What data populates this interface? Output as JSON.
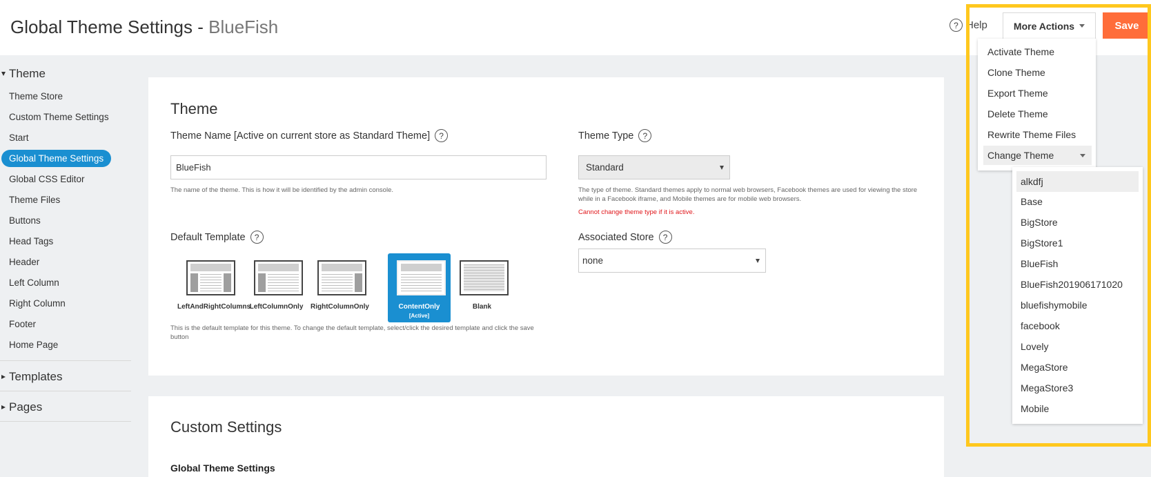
{
  "header": {
    "title": "Global Theme Settings - ",
    "title_theme": "BlueFish",
    "help_label": "Help",
    "help_icon": "?",
    "more_actions_label": "More Actions",
    "save_label": "Save"
  },
  "sidebar": {
    "theme_section": "Theme",
    "items": [
      {
        "label": "Theme Store"
      },
      {
        "label": "Custom Theme Settings"
      },
      {
        "label": "Start"
      },
      {
        "label": "Global Theme Settings"
      },
      {
        "label": "Global CSS Editor"
      },
      {
        "label": "Theme Files"
      },
      {
        "label": "Buttons"
      },
      {
        "label": "Head Tags"
      },
      {
        "label": "Header"
      },
      {
        "label": "Left Column"
      },
      {
        "label": "Right Column"
      },
      {
        "label": "Footer"
      },
      {
        "label": "Home Page"
      }
    ],
    "active_item": "Global Theme Settings",
    "templates_section": "Templates",
    "pages_section": "Pages"
  },
  "theme_panel": {
    "title": "Theme",
    "name_label": "Theme Name [Active on current store as Standard Theme]",
    "name_value": "BlueFish",
    "name_help": "The name of the theme. This is how it will be identified by the admin console.",
    "type_label": "Theme Type",
    "type_value": "Standard",
    "type_help": "The type of theme. Standard themes apply to normal web browsers, Facebook themes are used for viewing the store while in a Facebook iframe, and Mobile themes are for mobile web browsers.",
    "type_warning": "Cannot change theme type if it is active.",
    "template_label": "Default Template",
    "templates": [
      {
        "name": "LeftAndRightColumns"
      },
      {
        "name": "LeftColumnOnly"
      },
      {
        "name": "RightColumnOnly"
      },
      {
        "name": "ContentOnly",
        "tag": "[Active]"
      },
      {
        "name": "Blank"
      }
    ],
    "active_template": "ContentOnly",
    "template_help": "This is the default template for this theme. To change the default template, select/click the desired template and click the save button",
    "store_label": "Associated Store",
    "store_value": "none",
    "help_icon": "?"
  },
  "custom_panel": {
    "title": "Custom Settings",
    "subhead": "Global Theme Settings"
  },
  "more_actions_menu": {
    "items": [
      {
        "label": "Activate Theme"
      },
      {
        "label": "Clone Theme"
      },
      {
        "label": "Export Theme"
      },
      {
        "label": "Delete Theme"
      },
      {
        "label": "Rewrite Theme Files"
      },
      {
        "label": "Change Theme"
      }
    ]
  },
  "change_theme_menu": {
    "items": [
      {
        "label": "alkdfj"
      },
      {
        "label": "Base"
      },
      {
        "label": "BigStore"
      },
      {
        "label": "BigStore1"
      },
      {
        "label": "BlueFish"
      },
      {
        "label": "BlueFish201906171020"
      },
      {
        "label": "bluefishymobile"
      },
      {
        "label": "facebook"
      },
      {
        "label": "Lovely"
      },
      {
        "label": "MegaStore"
      },
      {
        "label": "MegaStore3"
      },
      {
        "label": "Mobile"
      }
    ],
    "highlighted": "alkdfj"
  },
  "colors": {
    "accent": "#1a8fd1",
    "save_button": "#ff6d3a",
    "highlight_frame": "#ffc81e",
    "warning": "#e0161a"
  },
  "icons": {
    "help": "question-circle-icon",
    "caret": "caret-down-icon",
    "section_expanded": "triangle-down-icon",
    "section_collapsed": "triangle-right-icon"
  }
}
